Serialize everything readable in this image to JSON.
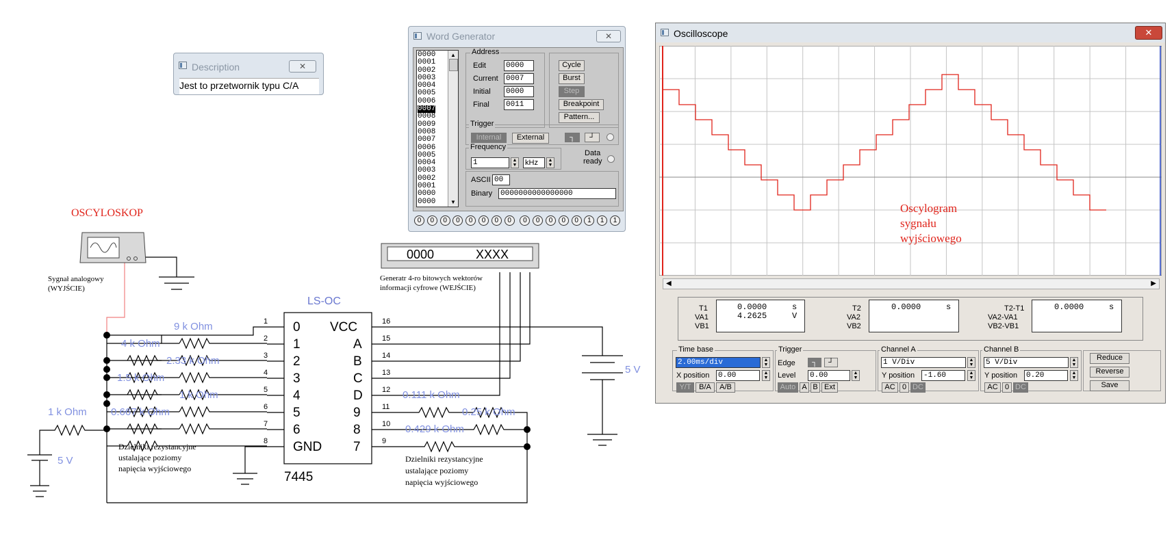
{
  "description_window": {
    "title": "Description",
    "text": "Jest to przetwornik typu C/A"
  },
  "word_generator": {
    "title": "Word Generator",
    "list": [
      "0000",
      "0001",
      "0002",
      "0003",
      "0004",
      "0005",
      "0006",
      "0007",
      "0008",
      "0009",
      "0008",
      "0007",
      "0006",
      "0005",
      "0004",
      "0003",
      "0002",
      "0001",
      "0000",
      "0000"
    ],
    "selected_index": 7,
    "address": {
      "group_label": "Address",
      "edit_label": "Edit",
      "edit_value": "0000",
      "current_label": "Current",
      "current_value": "0007",
      "initial_label": "Initial",
      "initial_value": "0000",
      "final_label": "Final",
      "final_value": "0011"
    },
    "buttons": {
      "cycle": "Cycle",
      "burst": "Burst",
      "step": "Step",
      "breakpoint": "Breakpoint",
      "pattern": "Pattern..."
    },
    "trigger": {
      "group_label": "Trigger",
      "internal": "Internal",
      "external": "External"
    },
    "frequency": {
      "group_label": "Frequency",
      "value": "1",
      "unit": "kHz"
    },
    "data_ready": {
      "line1": "Data",
      "line2": "ready"
    },
    "ascii_label": "ASCII",
    "ascii_value": "00",
    "binary_label": "Binary",
    "binary_value": "0000000000000000",
    "bits": [
      "0",
      "0",
      "0",
      "0",
      "0",
      "0",
      "0",
      "0",
      "0",
      "0",
      "0",
      "0",
      "0",
      "1",
      "1",
      "1"
    ]
  },
  "oscilloscope": {
    "title": "Oscilloscope",
    "trace_color": "#e0241b",
    "annotation": [
      "Oscylogram",
      "sygnału",
      "wyjściowego"
    ],
    "readout": {
      "t1_label": "T1",
      "t1_value": "0.0000",
      "t1_unit": "s",
      "va1_label": "VA1",
      "va1_value": "4.2625",
      "va1_unit": "V",
      "vb1_label": "VB1",
      "t2_label": "T2",
      "t2_value": "0.0000",
      "t2_unit": "s",
      "va2_label": "VA2",
      "vb2_label": "VB2",
      "t21_label": "T2-T1",
      "t21_value": "0.0000",
      "t21_unit": "s",
      "va21_label": "VA2-VA1",
      "vb21_label": "VB2-VB1"
    },
    "timebase": {
      "group_label": "Time base",
      "value": "2.00ms/div",
      "xpos_label": "X position",
      "xpos_value": "0.00",
      "yt": "Y/T",
      "ba": "B/A",
      "ab": "A/B"
    },
    "trigger": {
      "group_label": "Trigger",
      "edge_label": "Edge",
      "level_label": "Level",
      "level_value": "0.00",
      "auto": "Auto",
      "a": "A",
      "b": "B",
      "ext": "Ext"
    },
    "channel_a": {
      "group_label": "Channel A",
      "value": "1  V/Div",
      "ypos_label": "Y position",
      "ypos_value": "-1.60",
      "ac": "AC",
      "zero": "0",
      "dc": "DC"
    },
    "channel_b": {
      "group_label": "Channel B",
      "value": "5  V/Div",
      "ypos_label": "Y position",
      "ypos_value": "0.20",
      "ac": "AC",
      "zero": "0",
      "dc": "DC"
    },
    "side_buttons": {
      "reduce": "Reduce",
      "reverse": "Reverse",
      "save": "Save"
    },
    "trace_levels": [
      8,
      7,
      6,
      5,
      4,
      3,
      2,
      1,
      0,
      1,
      2,
      3,
      4,
      5,
      6,
      7,
      8,
      9,
      8,
      7,
      6,
      5,
      4,
      3,
      2,
      1,
      0
    ]
  },
  "circuit": {
    "oscyloskop_label": "OSCYLOSKOP",
    "signal_label": [
      "Sygnał analogowy",
      "(WYJŚCIE)"
    ],
    "generator_label": [
      "Generatr 4-ro bitowych wektorów",
      "informacji cyfrowe (WEJŚCIE)"
    ],
    "generator_display": {
      "left": "0000",
      "right": "XXXX"
    },
    "ic_name": "LS-OC",
    "ic_part": "7445",
    "ic_left_pins": [
      "0",
      "1",
      "2",
      "3",
      "4",
      "5",
      "6",
      "GND"
    ],
    "ic_right_pins": [
      "VCC",
      "A",
      "B",
      "C",
      "D",
      "9",
      "8",
      "7"
    ],
    "left_pin_numbers": [
      "1",
      "2",
      "3",
      "4",
      "5",
      "6",
      "7",
      "8"
    ],
    "right_pin_numbers": [
      "16",
      "15",
      "14",
      "13",
      "12",
      "11",
      "10",
      "9"
    ],
    "resistors_left": [
      "9 k Ohm",
      "4 k Ohm",
      "2.33 k Ohm",
      "1.5 k Ohm",
      "1 k Ohm",
      "0.667 k Ohm"
    ],
    "resistor_1k": "1 k Ohm",
    "resistors_right": [
      "0.111 k Ohm",
      "0.25 k Ohm",
      "0.429 k Ohm"
    ],
    "supply_left": "5 V",
    "supply_right": "5 V",
    "divider_note_left": [
      "Dzielniki rezystancyjne",
      "ustalające poziomy",
      "napięcia wyjściowego"
    ],
    "divider_note_right": [
      "Dzielniki rezystancyjne",
      "ustalające poziomy",
      "napięcia wyjściowego"
    ]
  }
}
